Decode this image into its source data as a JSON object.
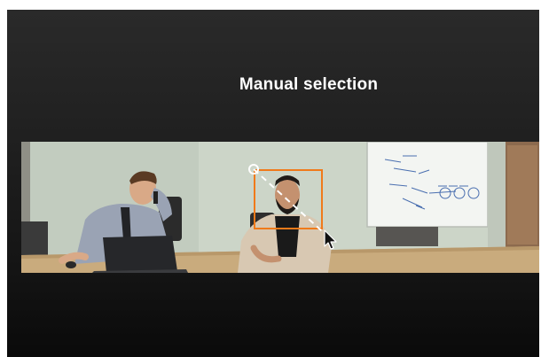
{
  "header": {
    "title": "Manual selection"
  },
  "video": {
    "selection_color": "#f07a1a"
  },
  "icons": {
    "cursor": "arrow-cursor-icon",
    "drag_start": "drag-start-handle-icon"
  }
}
